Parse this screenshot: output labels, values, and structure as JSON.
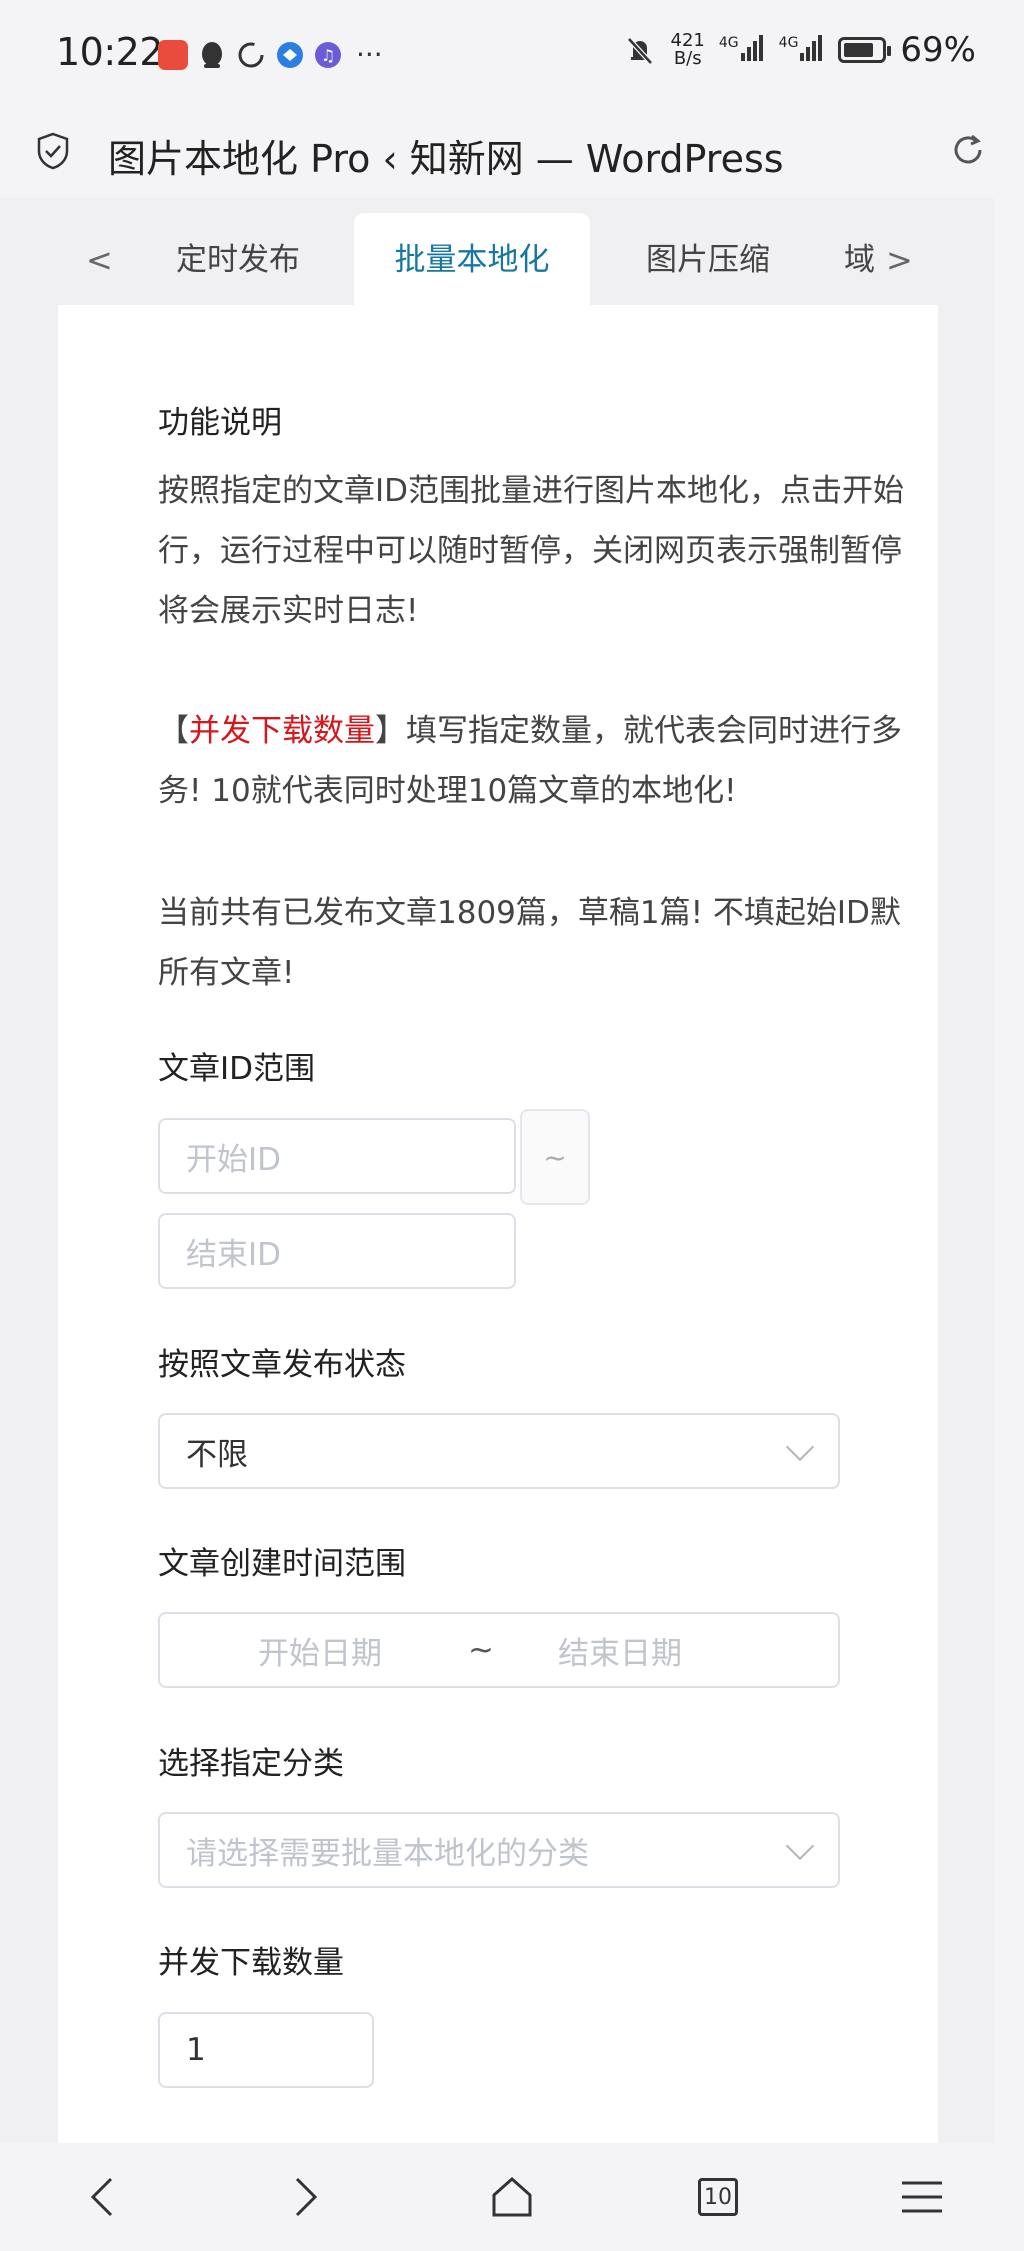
{
  "status_bar": {
    "time": "10:22",
    "net_speed_value": "421",
    "net_speed_unit": "B/s",
    "signal_1": "4G",
    "signal_2": "4G",
    "battery": "69%",
    "more": "···",
    "colors": {
      "app_red": "#e94c3d",
      "app_blue": "#2b7fe0",
      "app_purple": "#6b5bd6"
    }
  },
  "browser": {
    "title": "图片本地化 Pro ‹ 知新网 — WordPress",
    "icons": [
      "shield-check-icon",
      "reload-icon"
    ]
  },
  "tabs": {
    "prev_arrow": "<",
    "next_arrow": ">",
    "items": [
      {
        "label": "定时发布",
        "active": false
      },
      {
        "label": "批量本地化",
        "active": true
      },
      {
        "label": "图片压缩",
        "active": false
      },
      {
        "label": "域",
        "active": false
      }
    ],
    "active_color": "#1677a0"
  },
  "content": {
    "section_title": "功能说明",
    "desc_line1": "按照指定的文章ID范围批量进行图片本地化，点击开始",
    "desc_line2": "行，运行过程中可以随时暂停，关闭网页表示强制暂停",
    "desc_line3": "将会展示实时日志!",
    "concurrency_bracket_open": "【",
    "concurrency_highlight": "并发下载数量",
    "concurrency_bracket_close": "】",
    "concurrency_line1_rest": "填写指定数量，就代表会同时进行多",
    "concurrency_line2": "务! 10就代表同时处理10篇文章的本地化!",
    "stats_line1": "当前共有已发布文章1809篇，草稿1篇! 不填起始ID默",
    "stats_line2": "所有文章!",
    "highlight_color": "#d6161b"
  },
  "form": {
    "id_range": {
      "label": "文章ID范围",
      "start_placeholder": "开始ID",
      "separator": "~",
      "end_placeholder": "结束ID"
    },
    "status": {
      "label": "按照文章发布状态",
      "value": "不限"
    },
    "date_range": {
      "label": "文章创建时间范围",
      "start_placeholder": "开始日期",
      "separator": "~",
      "end_placeholder": "结束日期"
    },
    "category": {
      "label": "选择指定分类",
      "placeholder": "请选择需要批量本地化的分类"
    },
    "concurrency": {
      "label": "并发下载数量",
      "value": "1"
    }
  },
  "bottom_nav": {
    "tab_count": "10",
    "icons": [
      "back-icon",
      "forward-icon",
      "home-icon",
      "tabs-icon",
      "menu-icon"
    ]
  }
}
